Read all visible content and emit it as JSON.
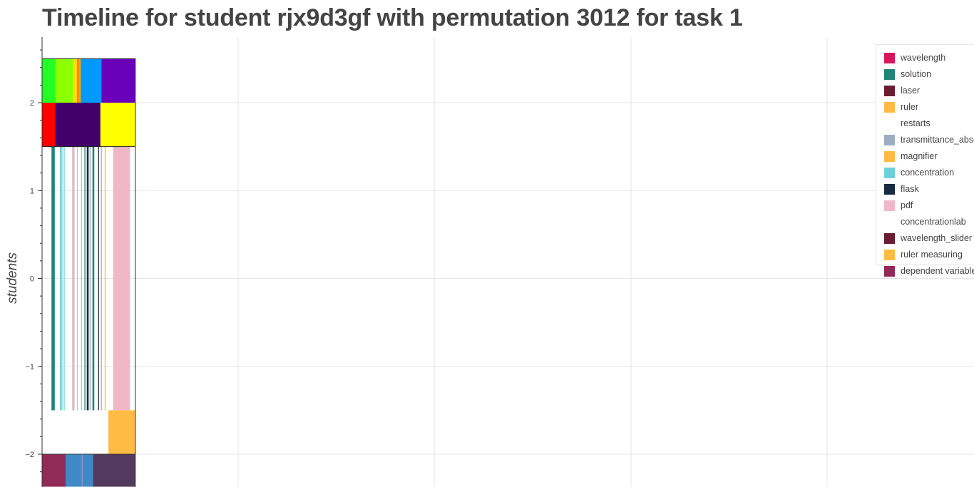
{
  "chart_data": {
    "type": "timeline",
    "title": "Timeline for student rjx9d3gf with permutation 3012 for task 1",
    "ylabel": "students",
    "xlabel": "",
    "y_ticks": [
      {
        "value": 2,
        "label": "2"
      },
      {
        "value": 1,
        "label": "1"
      },
      {
        "value": 0,
        "label": "0"
      },
      {
        "value": -1,
        "label": "−1"
      },
      {
        "value": -2,
        "label": "−2"
      }
    ],
    "ylim": [
      -2.37,
      2.73
    ],
    "grid": true,
    "legend_position": "top-right",
    "legend": [
      {
        "label": "wavelength",
        "color": "#d6175c"
      },
      {
        "label": "solution",
        "color": "#20847b"
      },
      {
        "label": "laser",
        "color": "#6a1d31"
      },
      {
        "label": "ruler",
        "color": "#ffbb44"
      },
      {
        "label": "restarts",
        "color": "#ffffff"
      },
      {
        "label": "transmittance_absorbance",
        "color": "#9eadbf"
      },
      {
        "label": "magnifier",
        "color": "#ffbb44"
      },
      {
        "label": "concentration",
        "color": "#6fd0dc"
      },
      {
        "label": "flask",
        "color": "#1a2b43"
      },
      {
        "label": "pdf",
        "color": "#f0b7c9"
      },
      {
        "label": "concentrationlab",
        "color": "#ffffff"
      },
      {
        "label": "wavelength_slider",
        "color": "#6a1d31"
      },
      {
        "label": "ruler measuring",
        "color": "#ffbb44"
      },
      {
        "label": "dependent variable",
        "color": "#922a57"
      }
    ],
    "x_domain": [
      0,
      100
    ],
    "rows": [
      {
        "y0": 2.0,
        "y1": 2.5,
        "segments": [
          {
            "x0": 0.0,
            "x1": 1.4,
            "color": "#22ff22"
          },
          {
            "x0": 1.4,
            "x1": 3.3,
            "color": "#8cff00"
          },
          {
            "x0": 3.3,
            "x1": 3.7,
            "color": "#ffdd00"
          },
          {
            "x0": 3.7,
            "x1": 4.0,
            "color": "#ff8800"
          },
          {
            "x0": 4.0,
            "x1": 4.1,
            "color": "#ffaa00"
          },
          {
            "x0": 4.1,
            "x1": 6.3,
            "color": "#0099ff"
          },
          {
            "x0": 6.3,
            "x1": 9.9,
            "color": "#6b00bb"
          }
        ]
      },
      {
        "y0": 1.5,
        "y1": 2.0,
        "segments": [
          {
            "x0": 0.0,
            "x1": 1.4,
            "color": "#ff0000"
          },
          {
            "x0": 1.4,
            "x1": 6.2,
            "color": "#41006a"
          },
          {
            "x0": 6.2,
            "x1": 9.9,
            "color": "#ffff00"
          }
        ]
      },
      {
        "y0": -1.5,
        "y1": 1.5,
        "segments": [
          {
            "x0": 1.0,
            "x1": 1.35,
            "color": "#20847b"
          },
          {
            "x0": 1.9,
            "x1": 2.1,
            "color": "#6fd0dc"
          },
          {
            "x0": 2.1,
            "x1": 2.2,
            "color": "#b9e6ec"
          },
          {
            "x0": 2.3,
            "x1": 2.4,
            "color": "#6fd0dc"
          },
          {
            "x0": 3.2,
            "x1": 3.45,
            "color": "#d8b8c8"
          },
          {
            "x0": 3.7,
            "x1": 3.8,
            "color": "#d8b8c8"
          },
          {
            "x0": 4.15,
            "x1": 4.2,
            "color": "#9eadbf"
          },
          {
            "x0": 4.5,
            "x1": 4.6,
            "color": "#20847b"
          },
          {
            "x0": 4.75,
            "x1": 4.95,
            "color": "#1a2b43"
          },
          {
            "x0": 5.05,
            "x1": 5.15,
            "color": "#9eadbf"
          },
          {
            "x0": 5.35,
            "x1": 5.55,
            "color": "#20847b"
          },
          {
            "x0": 5.95,
            "x1": 6.05,
            "color": "#1a2b43"
          },
          {
            "x0": 6.25,
            "x1": 6.35,
            "color": "#9eadbf"
          },
          {
            "x0": 6.65,
            "x1": 6.75,
            "color": "#ffbb44"
          },
          {
            "x0": 7.55,
            "x1": 9.35,
            "color": "#f0b7c9"
          }
        ]
      },
      {
        "y0": -2.0,
        "y1": -1.5,
        "segments": [
          {
            "x0": 7.05,
            "x1": 9.9,
            "color": "#ffbb44"
          }
        ]
      },
      {
        "y0": -2.37,
        "y1": -2.0,
        "segments": [
          {
            "x0": 0.0,
            "x1": 2.5,
            "color": "#922a57"
          },
          {
            "x0": 2.5,
            "x1": 4.2,
            "color": "#3f89c8"
          },
          {
            "x0": 4.2,
            "x1": 4.3,
            "color": "#9b7fae"
          },
          {
            "x0": 4.3,
            "x1": 5.4,
            "color": "#3f89c8"
          },
          {
            "x0": 5.4,
            "x1": 9.9,
            "color": "#54395e"
          }
        ]
      }
    ]
  }
}
